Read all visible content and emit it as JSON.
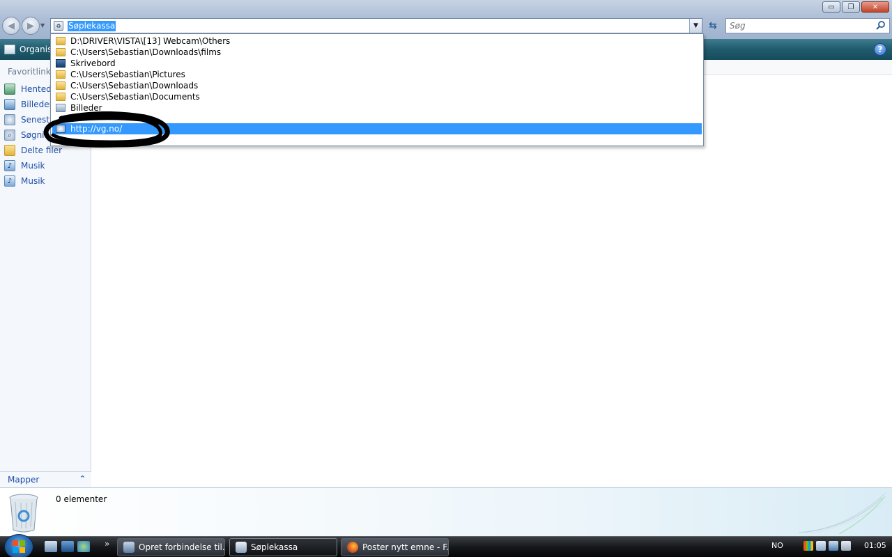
{
  "window": {
    "title_buttons": {
      "minimize": "▭",
      "restore": "❐",
      "close": "✕"
    }
  },
  "address": {
    "value": "Søplekassa",
    "search_placeholder": "Søg"
  },
  "toolbar": {
    "organize_label": "Organis",
    "help_label": "?"
  },
  "dropdown": {
    "items": [
      {
        "label": "D:\\DRIVER\\VISTA\\[13] Webcam\\Others",
        "icon": "folder-icon"
      },
      {
        "label": "C:\\Users\\Sebastian\\Downloads\\films",
        "icon": "folder-icon"
      },
      {
        "label": "Skrivebord",
        "icon": "desktop-icon"
      },
      {
        "label": "C:\\Users\\Sebastian\\Pictures",
        "icon": "folder-icon"
      },
      {
        "label": "C:\\Users\\Sebastian\\Downloads",
        "icon": "folder-icon"
      },
      {
        "label": "C:\\Users\\Sebastian\\Documents",
        "icon": "folder-icon"
      },
      {
        "label": "Billeder",
        "icon": "pictures-icon"
      },
      {
        "label": "",
        "icon": ""
      },
      {
        "label": "http://vg.no/",
        "icon": "web-page-icon",
        "selected": true
      }
    ]
  },
  "navpane": {
    "favorites_title": "Favoritlinks",
    "items": [
      {
        "label": "Hentede",
        "icon": "downloads-icon"
      },
      {
        "label": "Billeder",
        "icon": "pictures-icon"
      },
      {
        "label": "Senest",
        "icon": "recent-icon"
      },
      {
        "label": "Søgni",
        "icon": "searches-icon"
      },
      {
        "label": "Delte filer",
        "icon": "folder-icon"
      },
      {
        "label": "Musik",
        "icon": "music-icon"
      },
      {
        "label": "Musik",
        "icon": "music-icon"
      }
    ],
    "folders_label": "Mapper"
  },
  "details": {
    "count_text": "0 elementer"
  },
  "taskbar": {
    "tasks": [
      {
        "label": "Opret forbindelse til...",
        "icon": "network-icon",
        "active": false
      },
      {
        "label": "Søplekassa",
        "icon": "recycle-bin-icon",
        "active": true
      },
      {
        "label": "Poster nytt emne - F...",
        "icon": "firefox-icon",
        "active": false
      }
    ],
    "more_label": "»",
    "language": "NO",
    "clock": "01:05"
  },
  "colors": {
    "selection": "#3399ff",
    "toolbar": "#1f5a6c",
    "link": "#1e4fa8"
  }
}
